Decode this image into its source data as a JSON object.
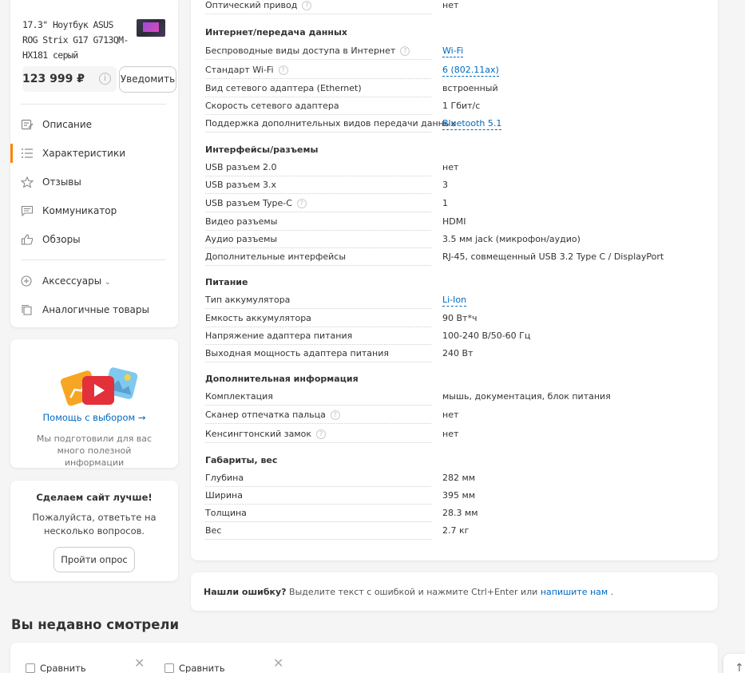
{
  "product": {
    "title": "17.3\" Ноутбук ASUS ROG Strix G17 G713QM-HX181 серый",
    "price": "123 999 ₽",
    "notify_label": "Уведомить"
  },
  "nav": {
    "items": [
      {
        "label": "Описание",
        "icon": "description-icon"
      },
      {
        "label": "Характеристики",
        "icon": "list-icon"
      },
      {
        "label": "Отзывы",
        "icon": "star-icon"
      },
      {
        "label": "Коммуникатор",
        "icon": "chat-icon"
      },
      {
        "label": "Обзоры",
        "icon": "thumbs-up-icon"
      }
    ],
    "extra": [
      {
        "label": "Аксессуары",
        "icon": "plus-circle-icon"
      },
      {
        "label": "Аналогичные товары",
        "icon": "copy-icon"
      }
    ]
  },
  "help": {
    "link": "Помощь с выбором →",
    "text": "Мы подготовили для вас много полезной информации"
  },
  "survey": {
    "title": "Сделаем сайт лучше!",
    "text": "Пожалуйста, ответьте на несколько вопросов.",
    "button": "Пройти опрос"
  },
  "specs": {
    "top_row": {
      "name": "Оптический привод",
      "value": "нет"
    },
    "groups": [
      {
        "title": "Интернет/передача данных",
        "rows": [
          {
            "name": "Беспроводные виды доступа в Интернет",
            "value": "Wi-Fi"
          },
          {
            "name": "Стандарт Wi-Fi",
            "value": "6 (802.11ax)"
          },
          {
            "name": "Вид сетевого адаптера (Ethernet)",
            "value": "встроенный"
          },
          {
            "name": "Скорость сетевого адаптера",
            "value": "1 Гбит/с"
          },
          {
            "name": "Поддержка дополнительных видов передачи данных",
            "value": "Bluetooth 5.1"
          }
        ]
      },
      {
        "title": "Интерфейсы/разъемы",
        "rows": [
          {
            "name": "USB разъем 2.0",
            "value": "нет"
          },
          {
            "name": "USB разъем 3.x",
            "value": "3"
          },
          {
            "name": "USB разъем Type-C",
            "value": "1"
          },
          {
            "name": "Видео разъемы",
            "value": "HDMI"
          },
          {
            "name": "Аудио разъемы",
            "value": "3.5 мм jack (микрофон/аудио)"
          },
          {
            "name": "Дополнительные интерфейсы",
            "value": "RJ-45, совмещенный USB 3.2 Type C / DisplayPort"
          }
        ]
      },
      {
        "title": "Питание",
        "rows": [
          {
            "name": "Тип аккумулятора",
            "value": "Li-Ion"
          },
          {
            "name": "Емкость аккумулятора",
            "value": "90 Вт*ч"
          },
          {
            "name": "Напряжение адаптера питания",
            "value": "100-240 В/50-60 Гц"
          },
          {
            "name": "Выходная мощность адаптера питания",
            "value": "240 Вт"
          }
        ]
      },
      {
        "title": "Дополнительная информация",
        "rows": [
          {
            "name": "Комплектация",
            "value": "мышь, документация, блок питания"
          },
          {
            "name": "Сканер отпечатка пальца",
            "value": "нет"
          },
          {
            "name": "Кенсингтонский замок",
            "value": "нет"
          }
        ]
      },
      {
        "title": "Габариты, вес",
        "rows": [
          {
            "name": "Глубина",
            "value": "282 мм"
          },
          {
            "name": "Ширина",
            "value": "395 мм"
          },
          {
            "name": "Толщина",
            "value": "28.3 мм"
          },
          {
            "name": "Вес",
            "value": "2.7 кг"
          }
        ]
      }
    ]
  },
  "error_note": {
    "bold": "Нашли ошибку?",
    "text": " Выделите текст с ошибкой и нажмите Ctrl+Enter или ",
    "link": "напишите нам",
    "tail": " ."
  },
  "recent": {
    "title": "Вы недавно смотрели",
    "compare_label": "Сравнить"
  },
  "colors": {
    "accent": "#fc8507",
    "link": "#0069c2"
  }
}
